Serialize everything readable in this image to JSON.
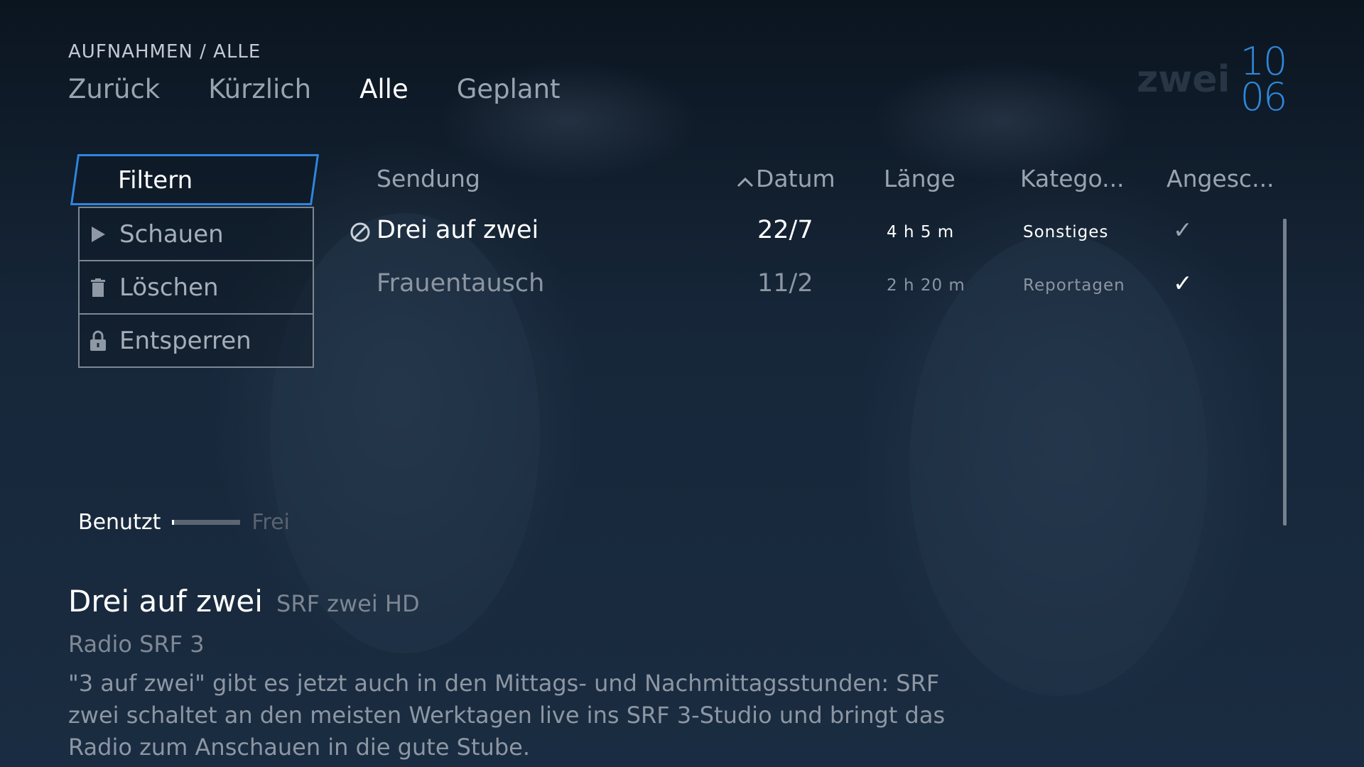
{
  "breadcrumb": "AUFNAHMEN / ALLE",
  "nav": {
    "tabs": [
      {
        "label": "Zurück"
      },
      {
        "label": "Kürzlich"
      },
      {
        "label": "Alle"
      },
      {
        "label": "Geplant"
      }
    ],
    "active": "Alle"
  },
  "clock": {
    "hours": "10",
    "minutes": "06"
  },
  "actions": {
    "filter_label": "Filtern",
    "items": [
      {
        "label": "Schauen",
        "icon": "play-icon"
      },
      {
        "label": "Löschen",
        "icon": "trash-icon"
      },
      {
        "label": "Entsperren",
        "icon": "unlock-icon"
      }
    ]
  },
  "table": {
    "headers": {
      "title": "Sendung",
      "date": "Datum",
      "length": "Länge",
      "category": "Katego...",
      "watched": "Angesc..."
    },
    "sort": {
      "column": "date",
      "direction": "ascending",
      "icon": "chevron-up-icon"
    },
    "rows": [
      {
        "title": "Drei auf zwei",
        "date": "22/7",
        "length": "4 h 5 m",
        "category": "Sonstiges",
        "watched": "✓",
        "status_icon": "blocked-icon"
      },
      {
        "title": "Frauentausch",
        "date": "11/2",
        "length": "2 h 20 m",
        "category": "Reportagen",
        "watched": "✓"
      }
    ]
  },
  "storage": {
    "used_label": "Benutzt",
    "free_label": "Frei",
    "used_fraction": 0.03
  },
  "detail": {
    "title": "Drei auf zwei",
    "channel": "SRF zwei HD",
    "subtitle": "Radio SRF 3",
    "description": "\"3 auf zwei\" gibt es jetzt auch in den Mittags- und Nachmittagsstunden: SRF zwei schaltet an den meisten Werktagen live ins SRF 3-Studio und bringt das Radio zum Anschauen in die gute Stube."
  },
  "colors": {
    "accent": "#2e86de",
    "clock": "#2f87d8"
  }
}
